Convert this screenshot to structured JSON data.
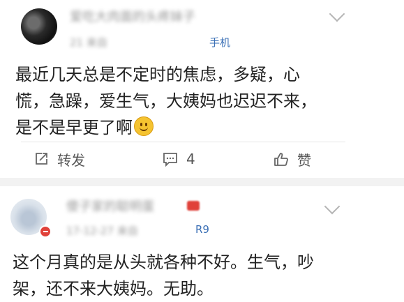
{
  "posts": [
    {
      "username": "爱吃大肉面的头疼妹子",
      "meta": "21 来自",
      "meta_tail": "手机",
      "content_lines": [
        "最近几天总是不定时的焦虑，多疑，心",
        "慌，急躁，爱生气，大姨妈也迟迟不来，",
        "是不是早更了啊"
      ],
      "actions": {
        "forward_label": "转发",
        "comment_count": "4",
        "like_label": "赞"
      }
    },
    {
      "username": "傻子家的聪明蛋",
      "meta": "17-12-27 来自",
      "meta_tail": "R9",
      "content_lines": [
        "这个月真的是从头就各种不好。生气，吵",
        "架，还不来大姨妈。无助。"
      ]
    }
  ],
  "icons": [
    "chevron-down-icon",
    "forward-icon",
    "comment-icon",
    "like-icon",
    "smiley-emoji-icon"
  ]
}
